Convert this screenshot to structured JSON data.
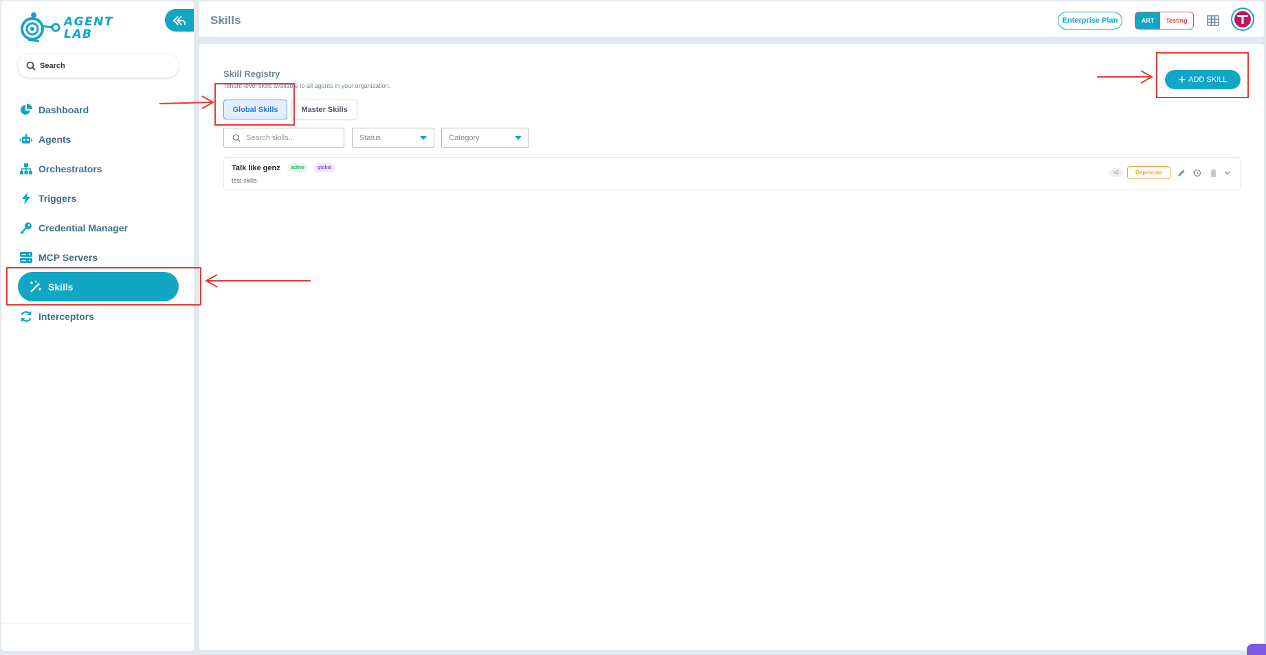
{
  "brand": {
    "line1": "AGENT",
    "line2": "LAB",
    "color": "#11a6c4"
  },
  "sidebar": {
    "search_placeholder": "Search",
    "items": [
      {
        "label": "Dashboard",
        "icon": "pie-chart-icon"
      },
      {
        "label": "Agents",
        "icon": "robot-icon"
      },
      {
        "label": "Orchestrators",
        "icon": "sitemap-icon"
      },
      {
        "label": "Triggers",
        "icon": "bolt-icon"
      },
      {
        "label": "Credential Manager",
        "icon": "key-icon"
      },
      {
        "label": "MCP Servers",
        "icon": "server-icon"
      },
      {
        "label": "Skills",
        "icon": "magic-wand-icon",
        "active": true
      },
      {
        "label": "Interceptors",
        "icon": "sync-icon"
      }
    ]
  },
  "header": {
    "title": "Skills",
    "plan_label": "Enterprise Plan",
    "env": {
      "art": "ART",
      "testing": "Testing"
    }
  },
  "main": {
    "registry_title": "Skill Registry",
    "registry_subtitle": "Tenant-level skills available to all agents in your organization.",
    "tabs": [
      {
        "label": "Global Skills",
        "active": true
      },
      {
        "label": "Master Skills",
        "active": false
      }
    ],
    "search_placeholder": "Search skills...",
    "status_select": "Status",
    "category_select": "Category",
    "add_button": "ADD SKILL",
    "skills": [
      {
        "name": "Talk like genz",
        "status": "active",
        "scope": "global",
        "description": "test skills",
        "version": "v2",
        "deprecate_label": "Deprecate"
      }
    ]
  },
  "colors": {
    "accent": "#11a6c4",
    "annotation": "#e53935",
    "nav_text": "#3f6f86"
  }
}
